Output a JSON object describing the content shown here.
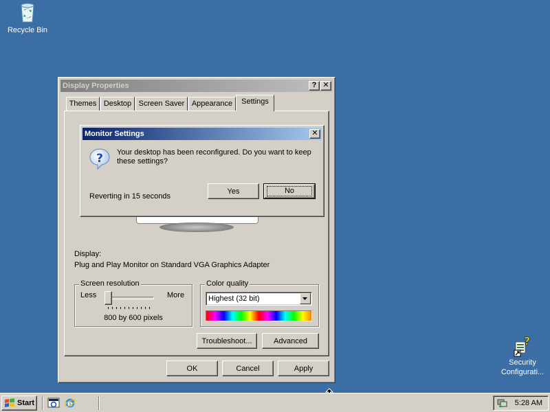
{
  "desktop": {
    "recycle_bin_label": "Recycle Bin",
    "security_label_line1": "Security",
    "security_label_line2": "Configurati..."
  },
  "display_properties": {
    "title": "Display Properties",
    "help_button": "?",
    "close_button": "✕",
    "tabs": [
      "Themes",
      "Desktop",
      "Screen Saver",
      "Appearance",
      "Settings"
    ],
    "selected_tab": "Settings",
    "display_label": "Display:",
    "display_value": "Plug and Play Monitor on Standard VGA Graphics Adapter",
    "screen_resolution": {
      "title": "Screen resolution",
      "less_label": "Less",
      "more_label": "More",
      "value_text": "800 by 600 pixels",
      "slider_level": 0
    },
    "color_quality": {
      "title": "Color quality",
      "selected": "Highest (32 bit)"
    },
    "troubleshoot_button": "Troubleshoot...",
    "advanced_button": "Advanced",
    "ok_button": "OK",
    "cancel_button": "Cancel",
    "apply_button": "Apply"
  },
  "monitor_settings": {
    "title": "Monitor Settings",
    "close_button": "✕",
    "message": "Your desktop has been reconfigured.  Do you want to keep these settings?",
    "countdown": "Reverting in 15 seconds",
    "yes_button": "Yes",
    "no_button": "No"
  },
  "taskbar": {
    "start_label": "Start",
    "clock": "5:28 AM"
  },
  "colors": {
    "desktop": "#3a6ea5",
    "active_title": "#0a246a",
    "inactive_title": "#808080",
    "face": "#d4d0c8"
  }
}
